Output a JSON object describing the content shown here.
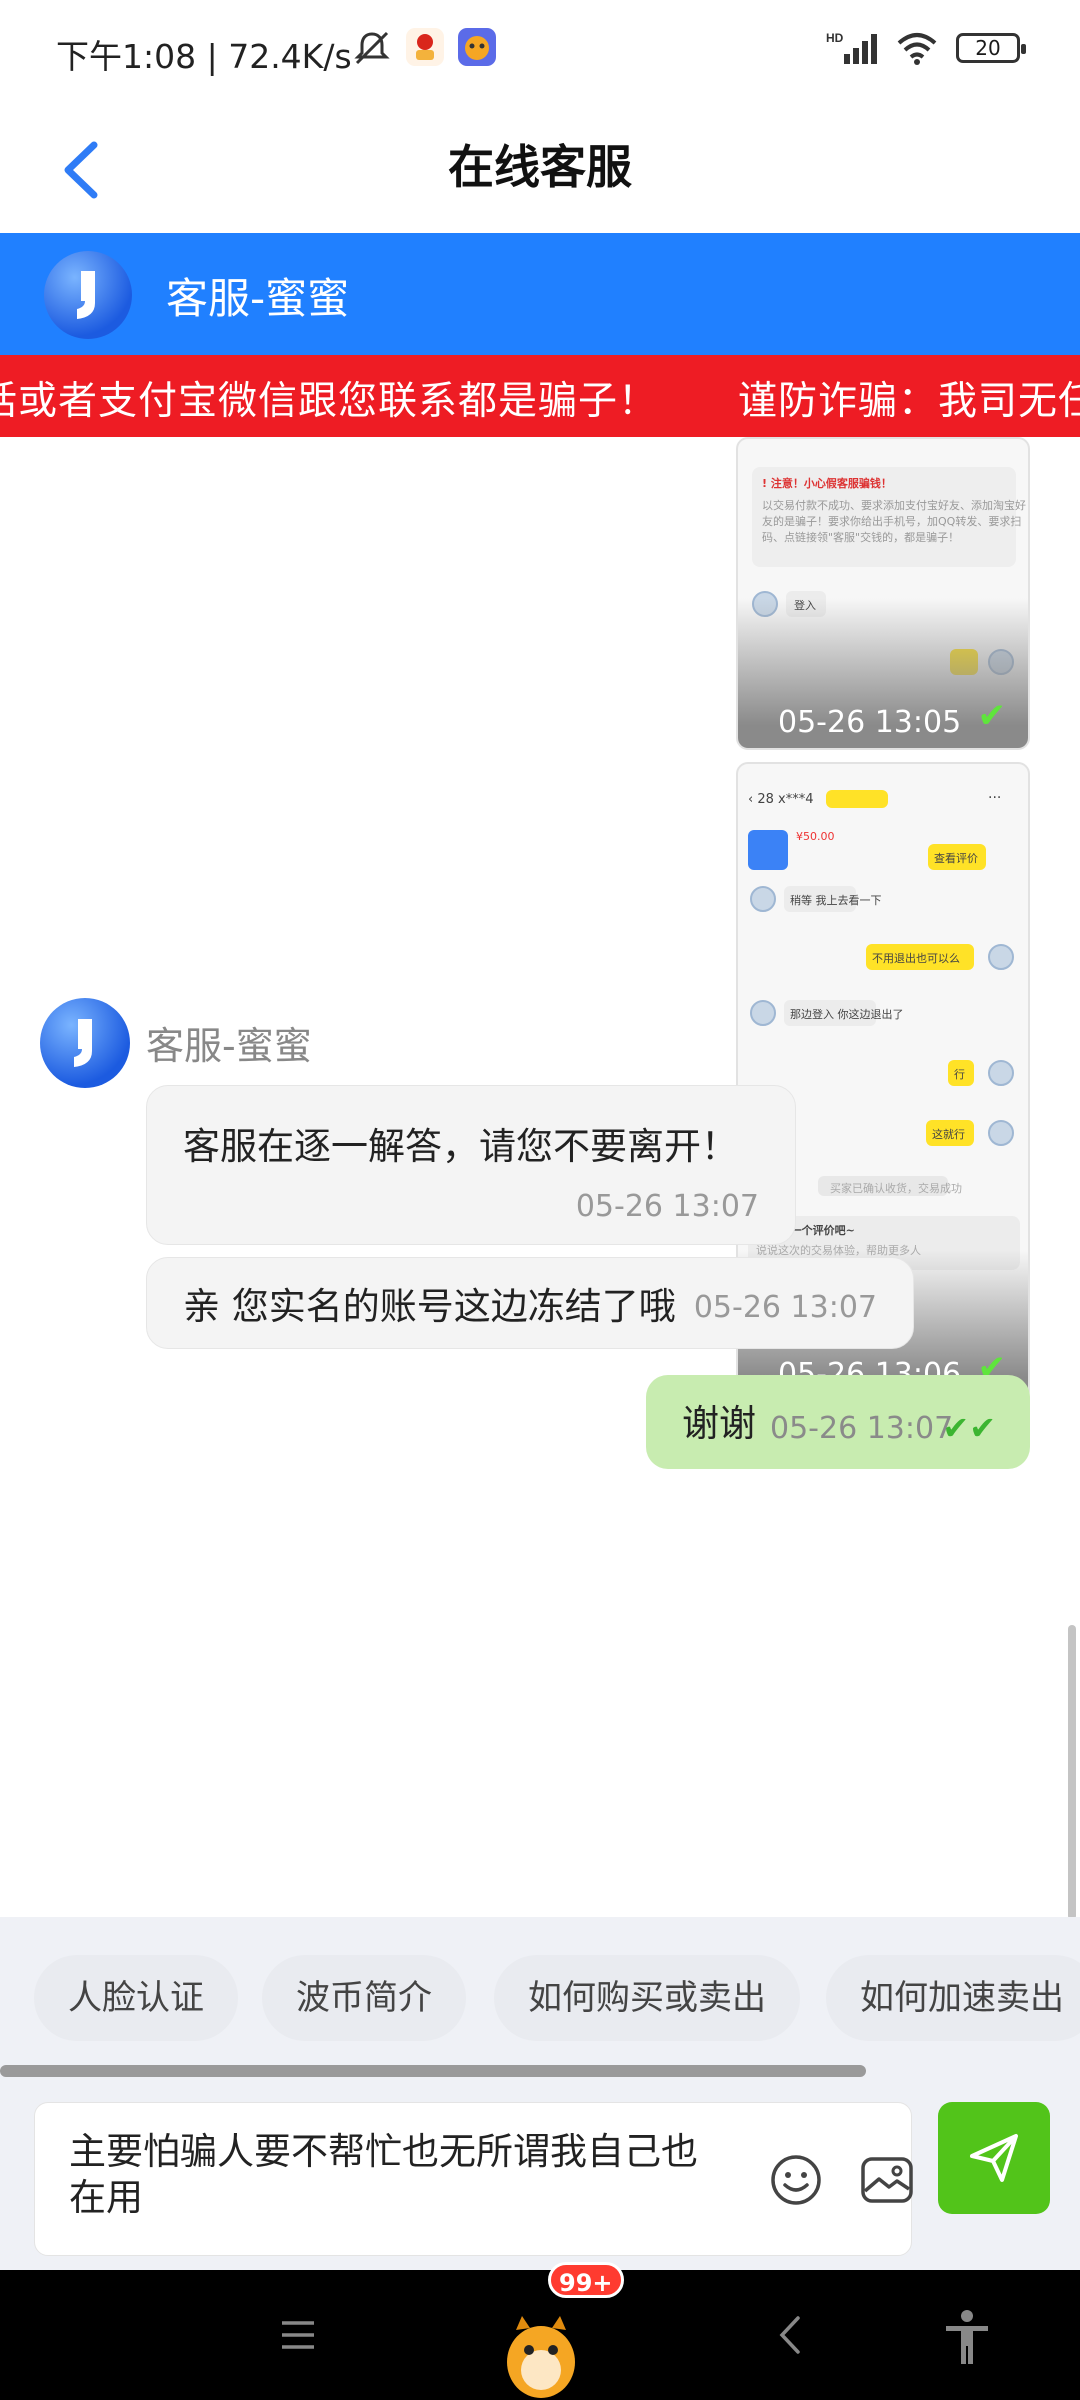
{
  "status_bar": {
    "time_text": "下午1:08 | 72.4K/s",
    "battery": "20"
  },
  "header": {
    "title": "在线客服",
    "agent_name": "客服-蜜蜜"
  },
  "marquee": {
    "text": "话或者支付宝微信跟您联系都是骗子！　　谨防诈骗：我司无任何线"
  },
  "screenshots": [
    {
      "time": "05-26 13:05"
    },
    {
      "time": "05-26 13:06"
    }
  ],
  "messages": {
    "sender_name": "客服-蜜蜜",
    "incoming": [
      {
        "text": "客服在逐一解答，请您不要离开！",
        "time": "05-26 13:07"
      },
      {
        "text": "亲 您实名的账号这边冻结了哦",
        "time": "05-26 13:07"
      }
    ],
    "outgoing": {
      "text": "谢谢",
      "time": "05-26 13:07"
    }
  },
  "quick_replies": [
    "人脸认证",
    "波币简介",
    "如何购买或卖出",
    "如何加速卖出"
  ],
  "input": {
    "value": "主要怕骗人要不帮忙也无所谓我自己也在用"
  },
  "system_nav": {
    "badge": "99+"
  },
  "colors": {
    "brand_blue": "#2080ff",
    "warning_red": "#ee1c24",
    "send_green": "#52c41a",
    "outgoing_bubble": "#c8ecb0"
  },
  "icons": [
    "back-icon",
    "mute-icon",
    "signal-icon",
    "wifi-icon",
    "battery-icon",
    "emoji-icon",
    "image-icon",
    "send-icon",
    "menu-icon",
    "nav-back-icon",
    "accessibility-icon"
  ]
}
